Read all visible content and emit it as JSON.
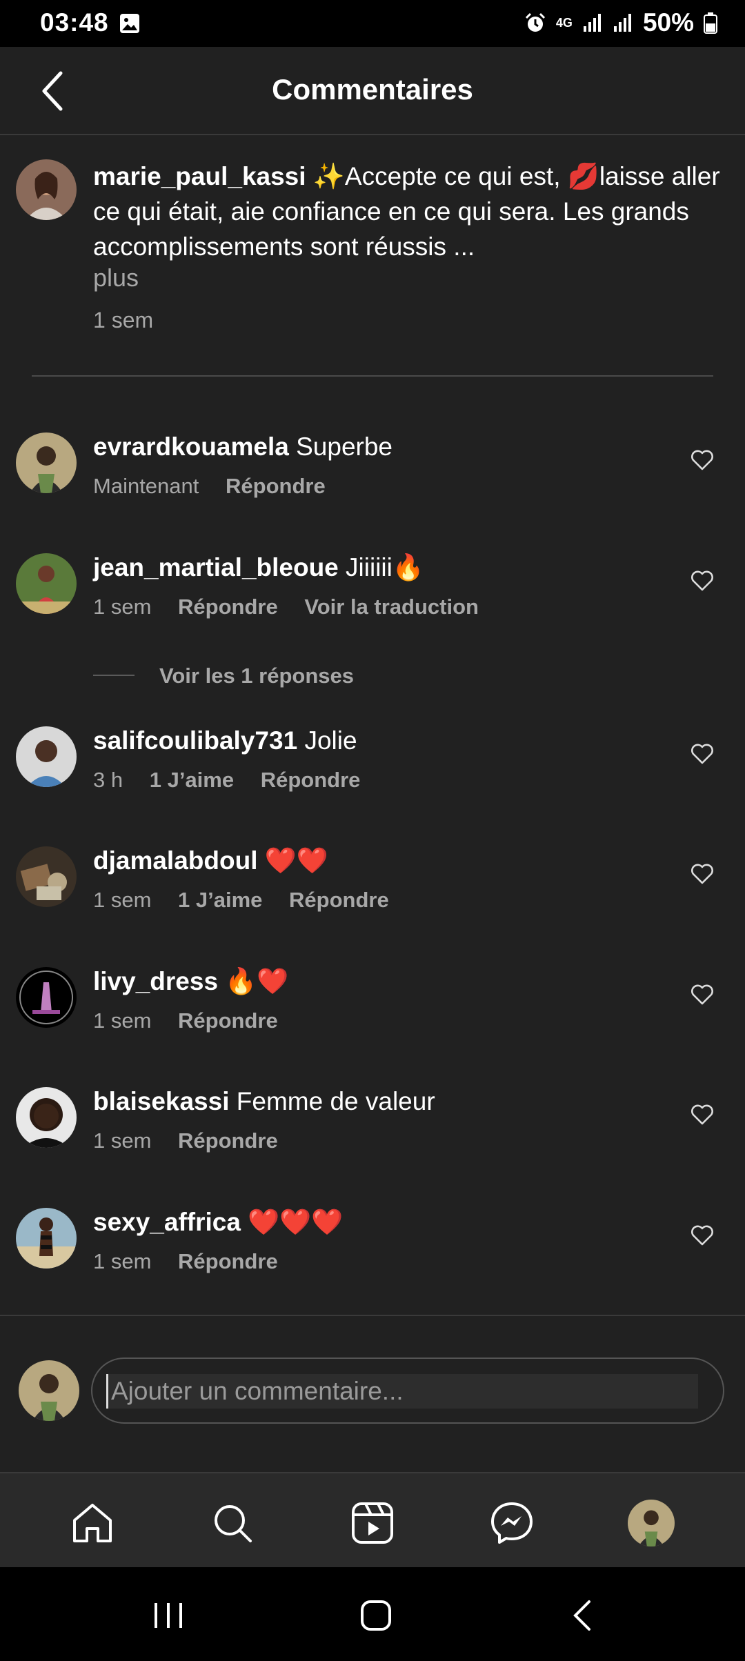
{
  "status_bar": {
    "time": "03:48",
    "network": "4G",
    "battery": "50%"
  },
  "header": {
    "title": "Commentaires"
  },
  "caption": {
    "username": "marie_paul_kassi",
    "text": "✨Accepte ce qui est, 💋laisse aller ce qui était, aie confiance en ce qui sera. Les grands accomplissements sont réussis ...",
    "more": "plus",
    "time": "1 sem"
  },
  "comments": [
    {
      "username": "evrardkouamela",
      "text": "Superbe",
      "time": "Maintenant",
      "likes": "",
      "reply": "Répondre",
      "translate": ""
    },
    {
      "username": "jean_martial_bleoue",
      "text": "Jiiiiii🔥",
      "time": "1 sem",
      "likes": "",
      "reply": "Répondre",
      "translate": "Voir la traduction"
    },
    {
      "username": "salifcoulibaly731",
      "text": "Jolie",
      "time": "3 h",
      "likes": "1 J’aime",
      "reply": "Répondre",
      "translate": ""
    },
    {
      "username": "djamalabdoul",
      "text": "❤️❤️",
      "time": "1 sem",
      "likes": "1 J’aime",
      "reply": "Répondre",
      "translate": ""
    },
    {
      "username": "livy_dress",
      "text": "🔥❤️",
      "time": "1 sem",
      "likes": "",
      "reply": "Répondre",
      "translate": ""
    },
    {
      "username": "blaisekassi",
      "text": "Femme de valeur",
      "time": "1 sem",
      "likes": "",
      "reply": "Répondre",
      "translate": ""
    },
    {
      "username": "sexy_affrica",
      "text": "❤️❤️❤️",
      "time": "1 sem",
      "likes": "",
      "reply": "Répondre",
      "translate": ""
    }
  ],
  "view_replies": "Voir les 1 réponses",
  "composer": {
    "placeholder": "Ajouter un commentaire..."
  },
  "bottom_nav": [
    "home-icon",
    "search-icon",
    "reels-icon",
    "messenger-icon",
    "profile-avatar"
  ],
  "colors": {
    "background": "#212121",
    "secondary_text": "#a8a8a8",
    "divider": "#3a3a3a"
  }
}
